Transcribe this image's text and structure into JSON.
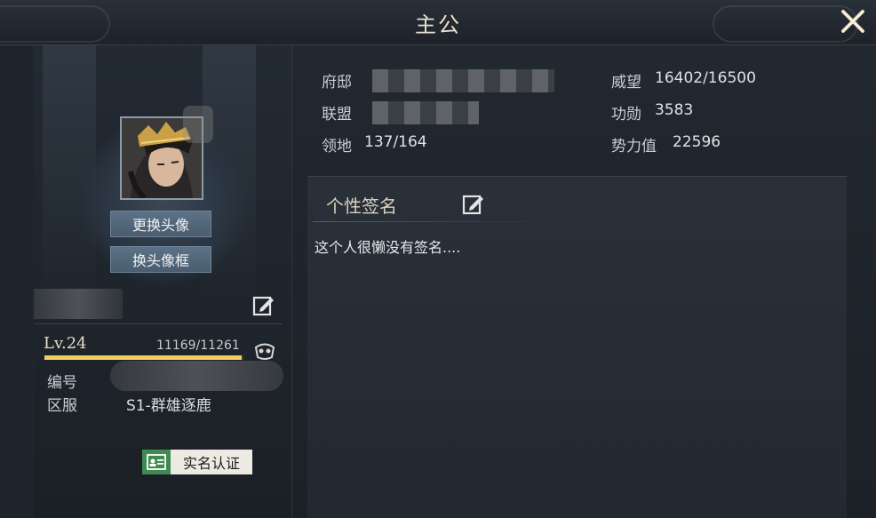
{
  "window": {
    "title": "主公",
    "close_icon": "close-x-icon"
  },
  "profile": {
    "change_avatar_label": "更换头像",
    "change_frame_label": "换头像框",
    "level": "Lv.24",
    "exp_text": "11169/11261",
    "exp_fraction": 0.9918,
    "id_label": "编号",
    "server_label": "区服",
    "server_value": "S1-群雄逐鹿",
    "realname_label": "实名认证"
  },
  "stats": {
    "mansion_label": "府邸",
    "alliance_label": "联盟",
    "territory_label": "领地",
    "territory_value": "137/164",
    "prestige_label": "威望",
    "prestige_value": "16402/16500",
    "merit_label": "功勋",
    "merit_value": "3583",
    "power_label": "势力值",
    "power_value": "22596"
  },
  "signature": {
    "title": "个性签名",
    "text": "这个人很懒没有签名...."
  },
  "colors": {
    "accent_gold": "#f0cf62",
    "button_slate": "#4a5d70",
    "realname_green": "#3f8a50"
  }
}
